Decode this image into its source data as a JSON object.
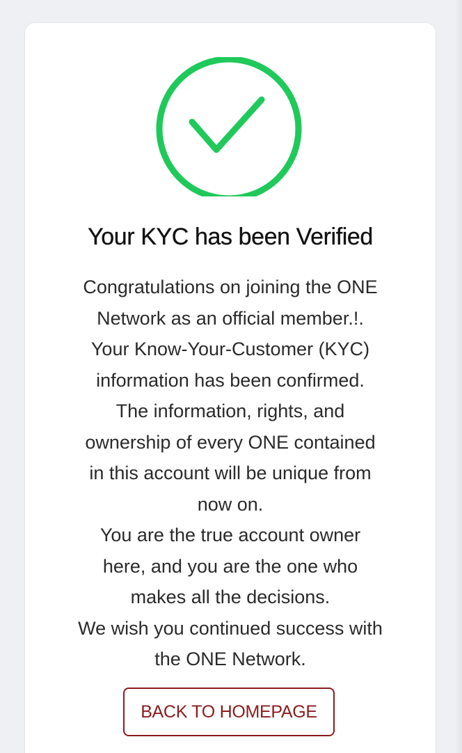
{
  "colors": {
    "success_green": "#1fc95a",
    "button_border": "#8b1c1c",
    "button_text": "#8b1c1c",
    "page_background": "#eef0f3",
    "card_background": "#ffffff"
  },
  "icon": {
    "status_icon": "check-circle-icon"
  },
  "kyc_card": {
    "title": "Your KYC has been Verified",
    "message_lines": [
      "Congratulations on joining the ONE",
      "Network as an official member.!.",
      "Your Know-Your-Customer (KYC)",
      "information has been confirmed.",
      "The information, rights, and",
      "ownership of every ONE contained",
      "in this account will be unique from",
      "now on.",
      "You are the true account owner",
      "here, and you are the one who",
      "makes all the decisions.",
      "We wish you continued success with",
      "the ONE Network."
    ],
    "back_button_label": "BACK TO HOMEPAGE"
  }
}
